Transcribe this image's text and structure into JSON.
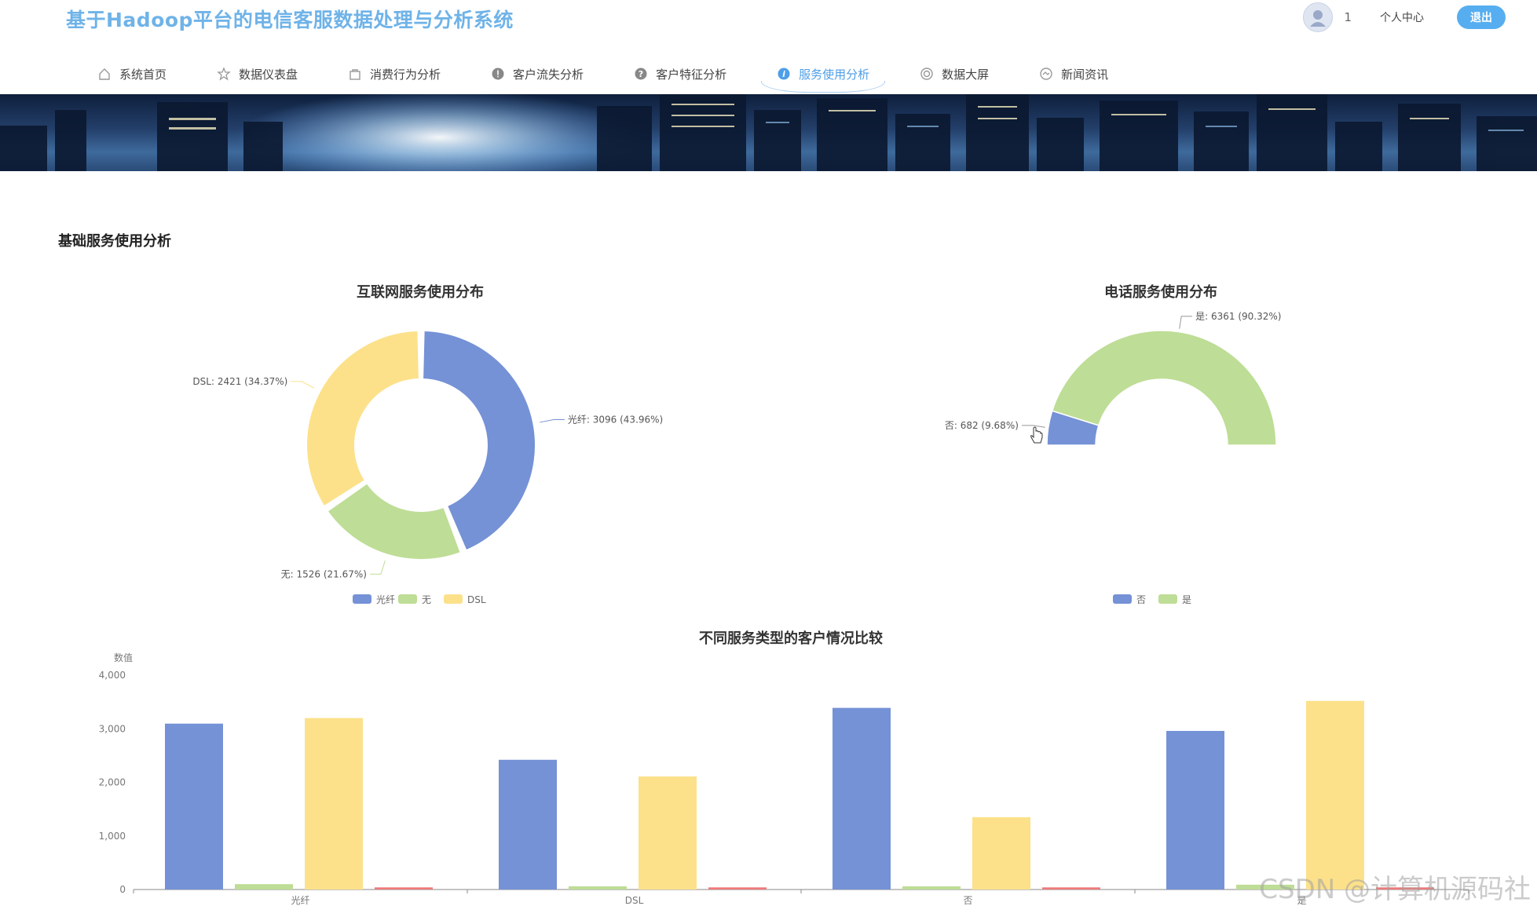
{
  "app": {
    "title": "基于Hadoop平台的电信客服数据处理与分析系统"
  },
  "user": {
    "name": "1",
    "personal_center": "个人中心",
    "logout": "退出"
  },
  "nav": [
    {
      "label": "系统首页",
      "icon": "home-icon",
      "active": false
    },
    {
      "label": "数据仪表盘",
      "icon": "star-icon",
      "active": false
    },
    {
      "label": "消费行为分析",
      "icon": "bag-icon",
      "active": false
    },
    {
      "label": "客户流失分析",
      "icon": "alert-circle-icon",
      "active": false
    },
    {
      "label": "客户特征分析",
      "icon": "help-circle-icon",
      "active": false
    },
    {
      "label": "服务使用分析",
      "icon": "info-circle-icon",
      "active": true
    },
    {
      "label": "数据大屏",
      "icon": "monitor-icon",
      "active": false
    },
    {
      "label": "新闻资讯",
      "icon": "news-icon",
      "active": false
    }
  ],
  "section": {
    "title": "基础服务使用分析"
  },
  "colors": {
    "blue": "#7592d6",
    "green": "#bedd96",
    "yellow": "#fce18a",
    "red": "#ee7a7a"
  },
  "watermark": "CSDN @计算机源码社",
  "chart_data": [
    {
      "type": "pie",
      "title": "互联网服务使用分布",
      "slices": [
        {
          "name": "光纤",
          "value": 3096,
          "label": "光纤: 3096 (43.96%)",
          "color": "#7592d6"
        },
        {
          "name": "无",
          "value": 1526,
          "label": "无: 1526 (21.67%)",
          "color": "#bedd96"
        },
        {
          "name": "DSL",
          "value": 2421,
          "label": "DSL: 2421 (34.37%)",
          "color": "#fce18a"
        }
      ],
      "legend": [
        "光纤",
        "无",
        "DSL"
      ],
      "legend_position": "bottom"
    },
    {
      "type": "pie",
      "title": "电话服务使用分布",
      "slices": [
        {
          "name": "否",
          "value": 682,
          "label": "否: 682 (9.68%)",
          "color": "#7592d6"
        },
        {
          "name": "是",
          "value": 6361,
          "label": "是: 6361 (90.32%)",
          "color": "#bedd96"
        }
      ],
      "legend": [
        "否",
        "是"
      ],
      "legend_position": "bottom"
    },
    {
      "type": "bar",
      "title": "不同服务类型的客户情况比较",
      "ylabel": "数值",
      "categories": [
        "光纤",
        "DSL",
        "否",
        "是"
      ],
      "ylim": [
        0,
        4000
      ],
      "yticks": [
        "0",
        "1,000",
        "2,000",
        "3,000",
        "4,000"
      ],
      "series": [
        {
          "values": [
            3096,
            2421,
            3390,
            2960
          ],
          "color": "#7592d6"
        },
        {
          "values": [
            100,
            60,
            60,
            90
          ],
          "color": "#bedd96"
        },
        {
          "values": [
            3200,
            2110,
            1350,
            3520
          ],
          "color": "#fce18a"
        },
        {
          "values": [
            40,
            40,
            40,
            40
          ],
          "color": "#ee7a7a"
        }
      ]
    }
  ]
}
